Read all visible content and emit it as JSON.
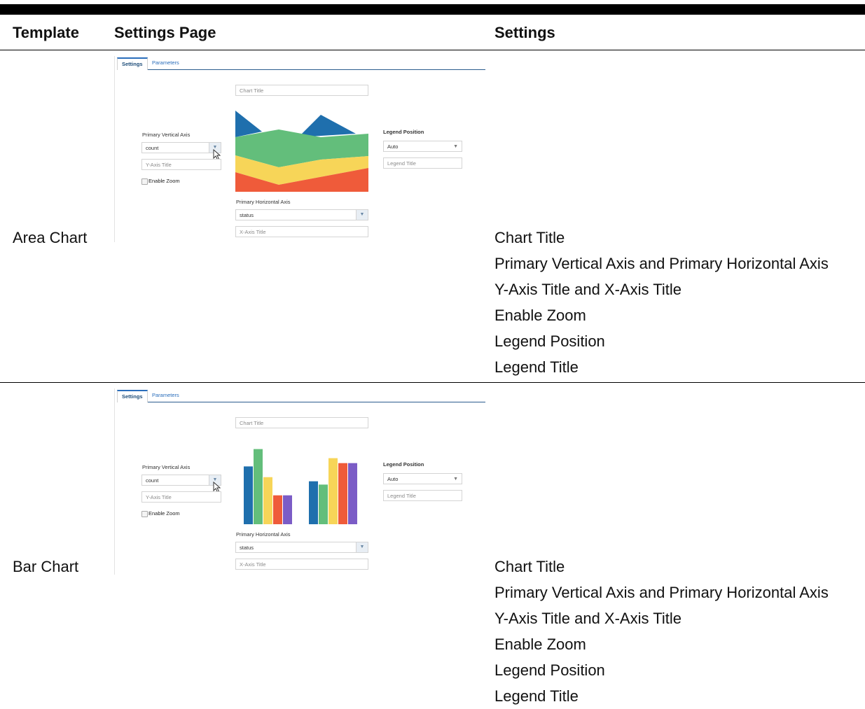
{
  "table": {
    "headers": {
      "template": "Template",
      "settings_page": "Settings Page",
      "settings": "Settings"
    },
    "rows": [
      {
        "template": "Area Chart",
        "panel": {
          "tabs": [
            "Settings",
            "Parameters"
          ],
          "chart_title_placeholder": "Chart Title",
          "primary_vertical_axis_label": "Primary Vertical Axis",
          "vertical_axis_value": "count",
          "y_axis_title_placeholder": "Y-Axis Title",
          "enable_zoom_label": "Enable Zoom",
          "legend_position_label": "Legend Position",
          "legend_position_value": "Auto",
          "legend_title_placeholder": "Legend Title",
          "primary_horizontal_axis_label": "Primary Horizontal Axis",
          "horizontal_axis_value": "status",
          "x_axis_title_placeholder": "X-Axis Title"
        },
        "settings": [
          "Chart Title",
          "Primary Vertical Axis and Primary Horizontal Axis",
          "Y-Axis Title and X-Axis Title",
          "Enable Zoom",
          "Legend Position",
          "Legend Title"
        ]
      },
      {
        "template": "Bar Chart",
        "panel": {
          "tabs": [
            "Settings",
            "Parameters"
          ],
          "chart_title_placeholder": "Chart Title",
          "primary_vertical_axis_label": "Primary Vertical Axis",
          "vertical_axis_value": "count",
          "y_axis_title_placeholder": "Y-Axis Title",
          "enable_zoom_label": "Enable Zoom",
          "legend_position_label": "Legend Position",
          "legend_position_value": "Auto",
          "legend_title_placeholder": "Legend Title",
          "primary_horizontal_axis_label": "Primary Horizontal Axis",
          "horizontal_axis_value": "status",
          "x_axis_title_placeholder": "X-Axis Title"
        },
        "settings": [
          "Chart Title",
          "Primary Vertical Axis and Primary Horizontal Axis",
          "Y-Axis Title and X-Axis Title",
          "Enable Zoom",
          "Legend Position",
          "Legend Title"
        ]
      }
    ]
  },
  "colors": {
    "blue": "#1f6fad",
    "green": "#63be7b",
    "yellow": "#f7d558",
    "red": "#ef5b3a",
    "purple": "#7b5cc6",
    "tab_accent": "#2a6ebb"
  },
  "chart_data": [
    {
      "type": "area",
      "title": "",
      "xlabel": "",
      "ylabel": "",
      "series": [
        {
          "values": [
            2,
            1,
            2,
            1
          ]
        },
        {
          "values": [
            3,
            4,
            2,
            4
          ]
        },
        {
          "values": [
            1,
            1,
            1,
            1
          ]
        },
        {
          "values": [
            1,
            1,
            1,
            1
          ]
        }
      ]
    },
    {
      "type": "bar",
      "title": "",
      "xlabel": "",
      "ylabel": "",
      "series": [
        {
          "values": [
            7,
            5.2
          ]
        },
        {
          "values": [
            9.1,
            4.8
          ]
        },
        {
          "values": [
            5.7,
            8
          ]
        },
        {
          "values": [
            3.5,
            7.4
          ]
        },
        {
          "values": [
            3.5,
            7.4
          ]
        }
      ]
    }
  ]
}
